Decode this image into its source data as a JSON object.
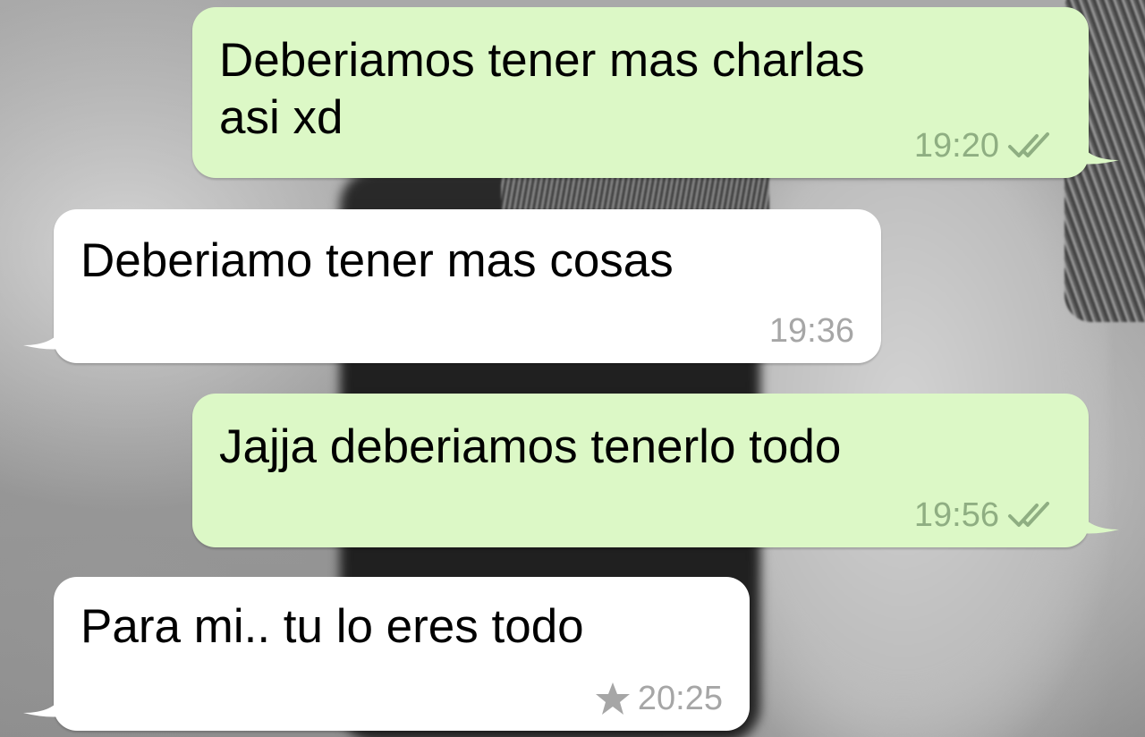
{
  "messages": [
    {
      "direction": "outgoing",
      "lines": [
        "Deberiamos tener mas charlas",
        "asi xd"
      ],
      "time": "19:20",
      "status_icon": "double-check-icon"
    },
    {
      "direction": "incoming",
      "lines": [
        "Deberiamo tener mas cosas"
      ],
      "time": "19:36"
    },
    {
      "direction": "outgoing",
      "lines": [
        "Jajja deberiamos tenerlo todo"
      ],
      "time": "19:56",
      "status_icon": "double-check-icon"
    },
    {
      "direction": "incoming",
      "lines": [
        "Para mi.. tu lo eres todo"
      ],
      "time": "20:25",
      "starred": true,
      "status_icon": "star-icon"
    }
  ],
  "colors": {
    "outgoing_bubble": "#dcf8c6",
    "incoming_bubble": "#ffffff",
    "outgoing_meta": "#8fae82",
    "incoming_meta": "#a6a6a6"
  }
}
